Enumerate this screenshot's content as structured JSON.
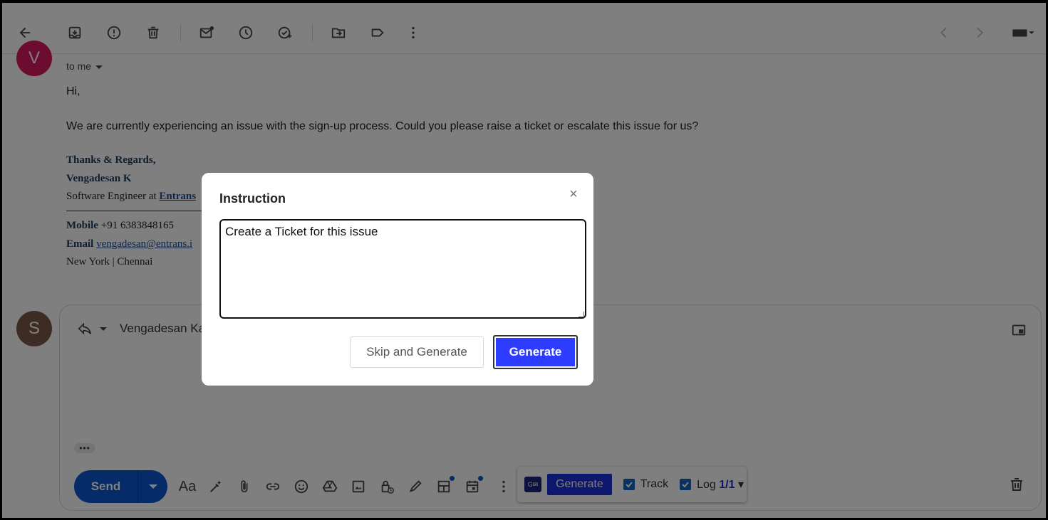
{
  "sender": {
    "avatar_letter": "V",
    "to_label": "to me"
  },
  "message": {
    "greeting": "Hi,",
    "body": "We are currently experiencing an issue with the sign-up process. Could you please raise a ticket or escalate this issue for us?"
  },
  "signature": {
    "closing": "Thanks & Regards,",
    "name": "Vengadesan K",
    "role_prefix": "Software Engineer at ",
    "company": "Entrans",
    "mobile_label": "Mobile",
    "mobile_value": "+91 6383848165",
    "email_label": "Email",
    "email_value": "vengadesan@entrans.i",
    "location": "New York | Chennai"
  },
  "reply": {
    "avatar_letter": "S",
    "recipient": "Vengadesan Ka",
    "more_label": "•••",
    "send_label": "Send",
    "format_label": "Aa"
  },
  "extension": {
    "logo_text": "G✉",
    "generate_label": "Generate",
    "track_label": "Track",
    "log_label": "Log",
    "log_count": "1/1",
    "log_caret": "▾"
  },
  "modal": {
    "title": "Instruction",
    "close_symbol": "×",
    "instruction_value": "Create a Ticket for this issue",
    "skip_label": "Skip and Generate",
    "generate_label": "Generate"
  },
  "colors": {
    "primary_blue": "#0b57d0",
    "generate_blue": "#2d3cff",
    "avatar_v": "#d81b60",
    "avatar_s": "#7b5846"
  }
}
